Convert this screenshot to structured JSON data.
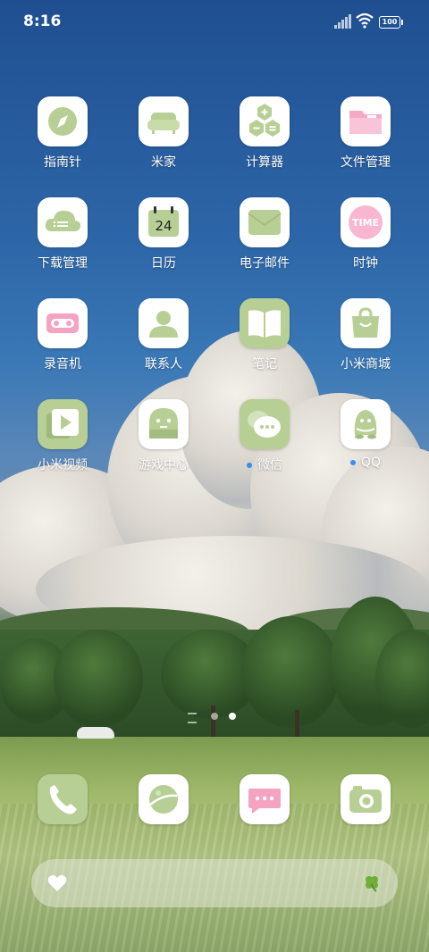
{
  "status_bar": {
    "time": "8:16",
    "battery": "100"
  },
  "apps": [
    {
      "label": "指南针",
      "icon": "compass-icon",
      "notify": false
    },
    {
      "label": "米家",
      "icon": "sofa-icon",
      "notify": false
    },
    {
      "label": "计算器",
      "icon": "calculator-icon",
      "notify": false
    },
    {
      "label": "文件管理",
      "icon": "folder-icon",
      "notify": false
    },
    {
      "label": "下载管理",
      "icon": "cloud-download-icon",
      "notify": false
    },
    {
      "label": "日历",
      "icon": "calendar-icon",
      "calendar_day": "24",
      "notify": false
    },
    {
      "label": "电子邮件",
      "icon": "mail-icon",
      "notify": false
    },
    {
      "label": "时钟",
      "icon": "clock-icon",
      "clock_text": "TIME",
      "notify": false
    },
    {
      "label": "录音机",
      "icon": "cassette-icon",
      "notify": false
    },
    {
      "label": "联系人",
      "icon": "person-icon",
      "notify": false
    },
    {
      "label": "笔记",
      "icon": "book-icon",
      "notify": false
    },
    {
      "label": "小米商城",
      "icon": "shopping-bag-icon",
      "notify": false
    },
    {
      "label": "小米视频",
      "icon": "video-play-icon",
      "notify": false
    },
    {
      "label": "游戏中心",
      "icon": "ghost-icon",
      "notify": false
    },
    {
      "label": "微信",
      "icon": "chat-bubbles-icon",
      "notify": true
    },
    {
      "label": "QQ",
      "icon": "penguin-icon",
      "notify": true
    }
  ],
  "dock": [
    {
      "icon": "phone-icon"
    },
    {
      "icon": "planet-icon"
    },
    {
      "icon": "message-icon"
    },
    {
      "icon": "camera-icon"
    }
  ],
  "page_indicator": {
    "pages": 2,
    "current": 2
  },
  "bottom_bar": {
    "left_icon": "heart-icon",
    "right_icon": "clover-icon"
  },
  "colors": {
    "accent_green": "#b7cf94",
    "pink": "#f4a3c0",
    "notify_dot": "#3b8cf0"
  }
}
